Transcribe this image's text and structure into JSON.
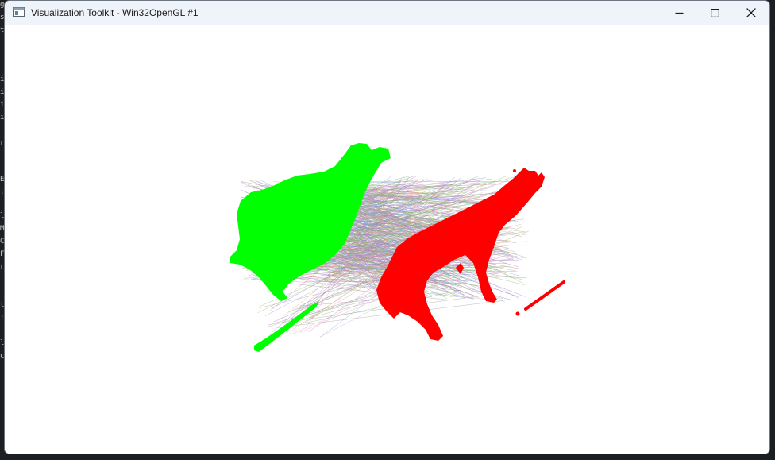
{
  "window": {
    "title": "Visualization Toolkit - Win32OpenGL #1",
    "icons": {
      "app": "vtk-window-icon",
      "minimize": "minimize-icon",
      "maximize": "maximize-icon",
      "close": "close-icon"
    }
  },
  "scene": {
    "background_color": "#ffffff",
    "source_cloud_color": "#00ff00",
    "target_cloud_color": "#ff0000",
    "correspondence_line_colors": [
      "#9b7bd6",
      "#7fb27f",
      "#d69b7b",
      "#7b9bd6",
      "#c07bc0",
      "#a0a0a0",
      "#8fbf6a",
      "#d6a3c0"
    ]
  },
  "desktop_behind": {
    "left_edge_chars": [
      "g",
      "s",
      "t",
      "",
      "i",
      "i",
      "i",
      "i",
      "",
      "r",
      "",
      "E",
      ":",
      "l",
      "M",
      "C",
      "F",
      "r",
      "",
      "t",
      ":",
      "",
      "l",
      "c"
    ]
  }
}
